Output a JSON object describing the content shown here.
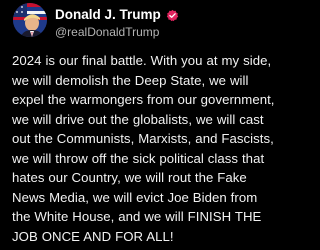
{
  "post": {
    "author": {
      "display_name": "Donald J. Trump",
      "handle": "@realDonaldTrump",
      "verified": true,
      "verified_badge_color": "#e0245e",
      "avatar_icon": "avatar-flag-portrait"
    },
    "body_lines": [
      "2024 is our final battle. With you at my side,",
      "we will demolish the Deep State, we will",
      "expel the warmongers from our government,",
      "we will drive out the globalists, we will cast",
      "out the Communists, Marxists, and Fascists,",
      "we will throw off the sick political class that",
      "hates our Country, we will rout the Fake",
      "News Media, we will evict Joe Biden from",
      "the White House, and we will FINISH THE",
      "JOB ONCE AND FOR ALL!"
    ]
  },
  "colors": {
    "background": "#000000",
    "text": "#f2f2f2",
    "handle": "#b3b3b3"
  }
}
